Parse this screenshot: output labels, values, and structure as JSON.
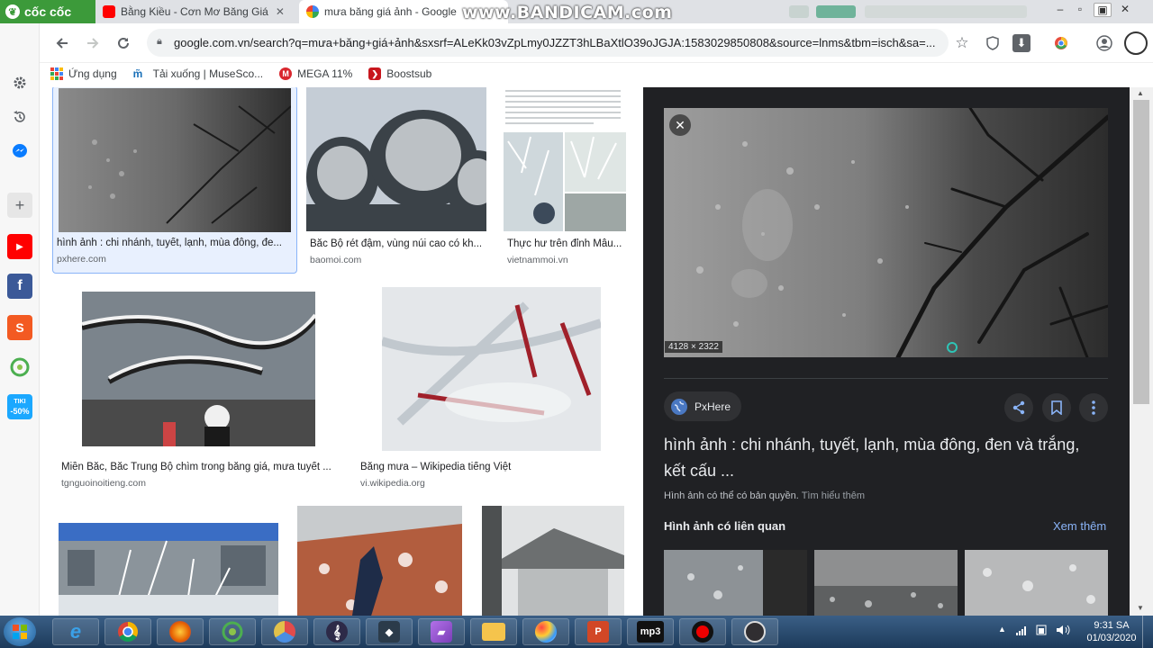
{
  "tabs": {
    "browser_brand": "cốc cốc",
    "items": [
      {
        "title": "Bằng Kiều - Cơn Mơ Băng Giá",
        "icon": "youtube-icon"
      },
      {
        "title": "mưa băng giá ảnh - Google",
        "icon": "google-icon"
      }
    ],
    "close": "✕",
    "new_tab": "+"
  },
  "watermark": "www.BANDICAM.com",
  "window_controls": {
    "minimize": "–",
    "maximize": "▫",
    "close": "✕"
  },
  "address_bar": {
    "url": "google.com.vn/search?q=mưa+băng+giá+ảnh&sxsrf=ALeKk03vZpLmy0JZZT3hLBaXtlO39oJGJA:1583029850808&source=lnms&tbm=isch&sa=..."
  },
  "bookmarks": [
    {
      "label": "Ứng dụng",
      "icon": "apps-grid-icon"
    },
    {
      "label": "Tải xuống | MuseSco...",
      "icon": "musescore-icon"
    },
    {
      "label": "MEGA 11%",
      "icon": "mega-icon"
    },
    {
      "label": "Boostsub",
      "icon": "boostsub-icon"
    }
  ],
  "sidebar": {
    "items": [
      "settings-icon",
      "history-icon",
      "messenger-icon",
      "add-icon",
      "youtube-icon",
      "facebook-icon",
      "shopee-icon",
      "coccoc-music-icon",
      "tiki-icon"
    ],
    "tiki_label": "-50%"
  },
  "results": [
    {
      "caption": "hình ảnh : chi nhánh, tuyết, lạnh, mùa đông, đe...",
      "source": "pxhere.com",
      "selected": true
    },
    {
      "caption": "Bắc Bộ rét đậm, vùng núi cao có kh...",
      "source": "baomoi.com"
    },
    {
      "caption": "Thực hư trên đỉnh Mẫu...",
      "source": "vietnammoi.vn"
    },
    {
      "caption": "Miền Bắc, Bắc Trung Bộ chìm trong băng giá, mưa tuyết ...",
      "source": "tgnguoinoitieng.com"
    },
    {
      "caption": "Băng mưa – Wikipedia tiếng Việt",
      "source": "vi.wikipedia.org"
    },
    {
      "caption": "",
      "source": ""
    },
    {
      "caption": "",
      "source": ""
    },
    {
      "caption": "",
      "source": ""
    }
  ],
  "detail": {
    "dimensions": "4128 × 2322",
    "source_name": "PxHere",
    "title": "hình ảnh : chi nhánh, tuyết, lạnh, mùa đông, đen và trắng, kết cấu ...",
    "copyright": "Hình ảnh có thể có bản quyền.",
    "learn_more": "Tìm hiểu thêm",
    "related_heading": "Hình ảnh có liên quan",
    "see_more": "Xem thêm",
    "close": "✕"
  },
  "taskbar": {
    "apps": [
      "internet-explorer-icon",
      "chrome-icon",
      "firefox-icon",
      "coccoc-icon",
      "davinci-resolve-icon",
      "musescore-icon",
      "filmora-icon",
      "onenote-icon",
      "file-explorer-icon",
      "paint-icon",
      "powerpoint-icon",
      "mp3-cutter-icon",
      "bandicam-record-icon",
      "obs-icon"
    ],
    "mp3_label": "mp3",
    "time": "9:31 SA",
    "date": "01/03/2020"
  }
}
